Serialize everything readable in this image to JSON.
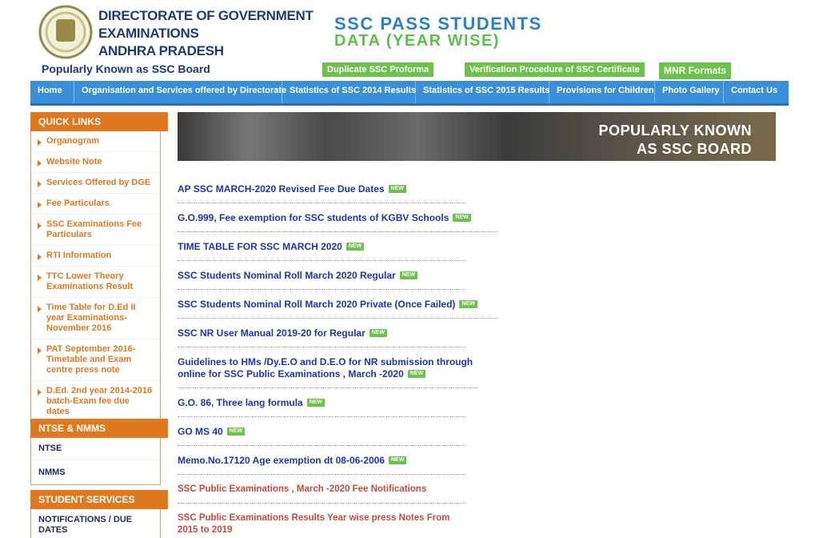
{
  "header": {
    "org_line1": "DIRECTORATE OF GOVERNMENT",
    "org_line2": "EXAMINATIONS",
    "org_line3": "ANDHRA PRADESH",
    "known_as": "Popularly Known as SSC Board",
    "title_line1": "SSC PASS STUDENTS",
    "title_line2": "DATA (YEAR WISE)",
    "buttons": [
      "Duplicate SSC Proforma",
      "Verification Procedure of SSC Certificate",
      "MNR Formats"
    ]
  },
  "nav": {
    "items": [
      "Home",
      "Organisation and Services offered by Directorate",
      "Statistics of SSC 2014 Results",
      "Statistics of SSC 2015 Results",
      "Provisions for Children",
      "Photo Gallery",
      "Contact Us"
    ]
  },
  "quick_links": {
    "title": "QUICK LINKS",
    "items": [
      "Organogram",
      "Website Note",
      "Services Offered by DGE",
      "Fee Particulars",
      "SSC Examinations Fee Particulars",
      "RTI Information",
      "TTC Lower Theory Examinations Result",
      "Time Table for D.Ed II year Examinations-November 2016",
      "PAT September 2016-Timetable and Exam centre press note",
      "D.Ed. 2nd year 2014-2016 batch-Exam fee due dates"
    ]
  },
  "ntse": {
    "title": "NTSE & NMMS",
    "items": [
      "NTSE",
      "NMMS"
    ]
  },
  "student_services": {
    "title": "STUDENT SERVICES",
    "items": [
      "NOTIFICATIONS / DUE DATES"
    ]
  },
  "banner": {
    "line1": "POPULARLY KNOWN",
    "line2": "AS SSC BOARD"
  },
  "new_badge": "NEW",
  "notices": [
    "AP SSC MARCH-2020 Revised Fee Due Dates",
    "G.O.999, Fee exemption for SSC students of KGBV Schools",
    "TIME TABLE FOR SSC MARCH 2020",
    "SSC Students Nominal Roll March 2020 Regular",
    "SSC Students Nominal Roll March 2020 Private (Once Failed)",
    "SSC NR User Manual 2019-20 for Regular",
    "Guidelines to HMs /Dy.E.O and D.E.O for NR submission through online for SSC Public Examinations , March -2020",
    "G.O. 86, Three lang formula",
    "GO MS 40",
    "Memo.No.17120 Age exemption dt 08-06-2006",
    "SSC Public Examinations , March -2020 Fee Notifications",
    "SSC Public Examinations Results Year wise press Notes From 2015 to 2019"
  ]
}
